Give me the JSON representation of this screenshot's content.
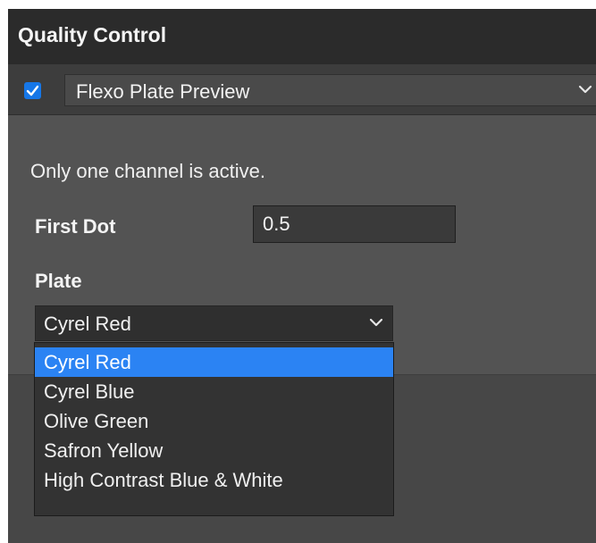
{
  "panel": {
    "title": "Quality Control",
    "enabled_checkbox": {
      "checked": true,
      "color": "#1677e8"
    },
    "mode_select": {
      "value": "Flexo Plate Preview",
      "icon": "chevron-down-icon"
    }
  },
  "content": {
    "info_text": "Only one channel is active.",
    "first_dot": {
      "label": "First Dot",
      "value": "0.5"
    },
    "plate": {
      "label": "Plate",
      "selected": "Cyrel Red",
      "icon": "chevron-down-icon",
      "options": [
        "Cyrel Red",
        "Cyrel Blue",
        "Olive Green",
        "Safron Yellow",
        "High Contrast Blue & White"
      ],
      "highlighted_color": "#2b83f3"
    }
  }
}
